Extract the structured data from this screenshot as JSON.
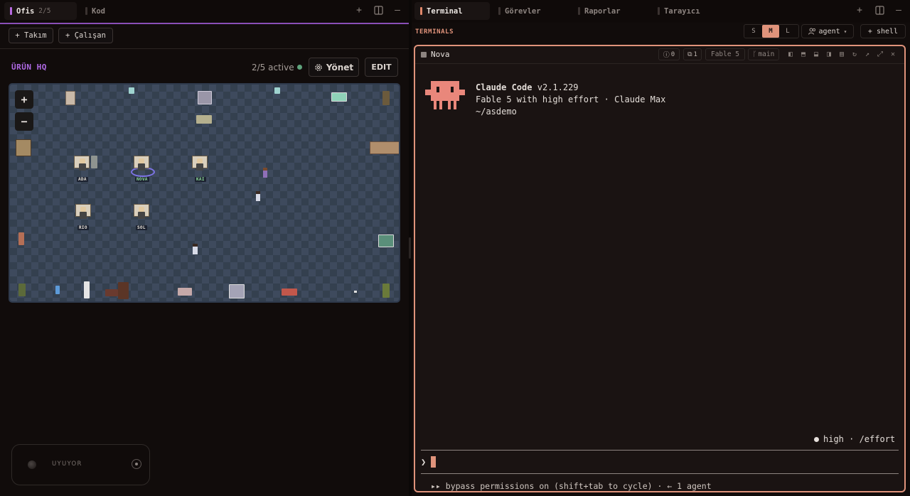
{
  "left_pane": {
    "tabs": [
      {
        "label": "Ofis",
        "count": "2/5",
        "bar_color": "#b76ae0"
      },
      {
        "label": "Kod"
      }
    ],
    "toolbar": {
      "add_team": "+ Takım",
      "add_employee": "+ Çalışan"
    },
    "office": {
      "title": "ÜRÜN HQ",
      "active_status": "2/5 active",
      "manage_label": "Yönet",
      "edit_label": "EDIT",
      "zoom_in": "+",
      "zoom_out": "−",
      "agents": [
        "ADA",
        "NOVA",
        "KAI",
        "RIO",
        "SOL"
      ]
    },
    "sleep_widget": {
      "label": "UYUYOR"
    }
  },
  "right_pane": {
    "tabs": [
      {
        "label": "Terminal",
        "bar_color": "#e0876a"
      },
      {
        "label": "Görevler"
      },
      {
        "label": "Raporlar"
      },
      {
        "label": "Tarayıcı"
      }
    ],
    "section_title": "TERMINALS",
    "sizes": [
      "S",
      "M",
      "L"
    ],
    "selected_size": "M",
    "agent_select": "agent",
    "shell_button": "+ shell",
    "terminal": {
      "name": "Nova",
      "errors": "0",
      "copies": "1",
      "model": "Fable 5",
      "branch": "main",
      "app_name": "Claude Code",
      "version": "v2.1.229",
      "model_line": "Fable 5 with high effort · Claude Max",
      "cwd": "~/asdemo",
      "effort_status": "high · /effort",
      "prompt_symbol": "❯",
      "footer": "▸▸ bypass permissions on (shift+tab to cycle) · ← 1 agent"
    }
  },
  "colors": {
    "accent_terminal": "#e0937b",
    "accent_office": "#b76ae0",
    "mascot": "#e9877b",
    "active_dot": "#5fa37c"
  }
}
